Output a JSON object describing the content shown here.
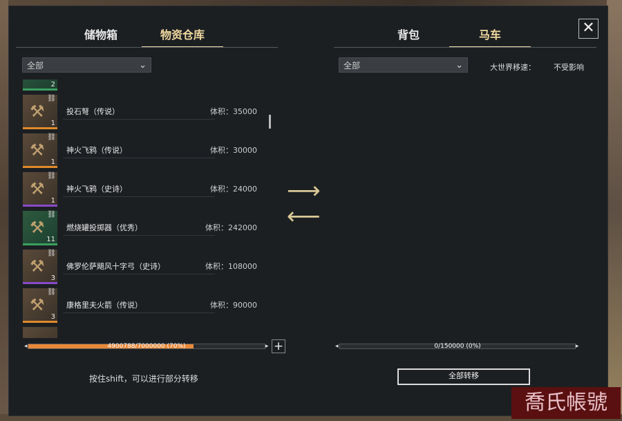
{
  "left_tabs": [
    {
      "label": "储物箱"
    },
    {
      "label": "物资仓库"
    }
  ],
  "right_tabs": [
    {
      "label": "背包"
    },
    {
      "label": "马车"
    }
  ],
  "close_label": "✕",
  "left_filter": {
    "value": "全部"
  },
  "right_filter": {
    "value": "全部"
  },
  "world_speed": {
    "label": "大世界移速：",
    "value": "不受影响"
  },
  "items": [
    {
      "name": "",
      "volume": "",
      "count": "2",
      "rarity": "good"
    },
    {
      "name": "投石弩（传说）",
      "volume": "体积：35000",
      "count": "1",
      "rarity": "legend"
    },
    {
      "name": "神火飞鸦（传说）",
      "volume": "体积：30000",
      "count": "1",
      "rarity": "legend"
    },
    {
      "name": "神火飞鸦（史诗）",
      "volume": "体积：24000",
      "count": "1",
      "rarity": "epic"
    },
    {
      "name": "燃烧罐投掷器（优秀）",
      "volume": "体积：242000",
      "count": "11",
      "rarity": "good"
    },
    {
      "name": "佛罗伦萨飓风十字弓（史诗）",
      "volume": "体积：108000",
      "count": "3",
      "rarity": "epic"
    },
    {
      "name": "康格里夫火箭（传说）",
      "volume": "体积：90000",
      "count": "3",
      "rarity": "legend"
    },
    {
      "name": "",
      "volume": "",
      "count": "",
      "rarity": "legend"
    }
  ],
  "left_capacity": {
    "text": "4900788/7000000 (70%)",
    "percent": 70
  },
  "right_capacity": {
    "text": "0/150000 (0%)",
    "percent": 0
  },
  "plus_label": "+",
  "hint": "按住shift，可以进行部分转移",
  "transfer_all": "全部转移",
  "watermark": "喬氏帳號"
}
